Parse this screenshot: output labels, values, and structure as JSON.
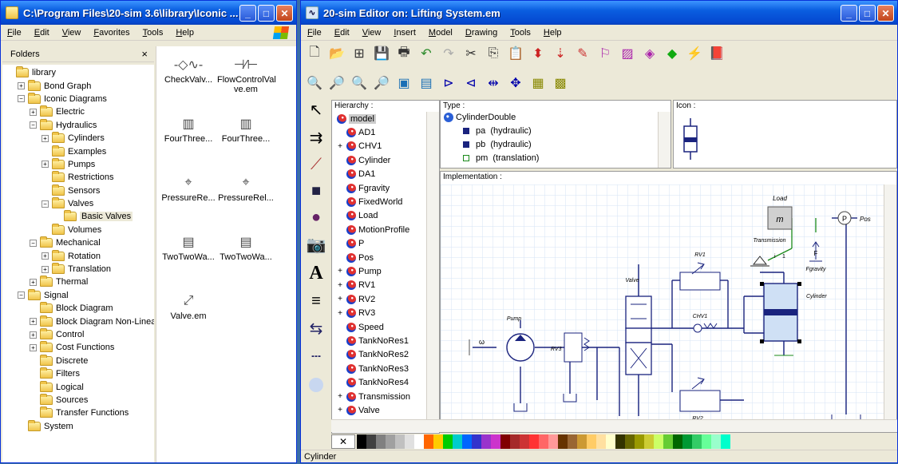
{
  "explorer": {
    "title": "C:\\Program Files\\20-sim 3.6\\library\\Iconic ...",
    "menu": [
      "File",
      "Edit",
      "View",
      "Favorites",
      "Tools",
      "Help"
    ],
    "folders_label": "Folders",
    "close_label": "×",
    "tree": [
      {
        "label": "library",
        "depth": 0,
        "pm": "",
        "selected": false
      },
      {
        "label": "Bond Graph",
        "depth": 1,
        "pm": "+",
        "selected": false
      },
      {
        "label": "Iconic Diagrams",
        "depth": 1,
        "pm": "−",
        "selected": false
      },
      {
        "label": "Electric",
        "depth": 2,
        "pm": "+",
        "selected": false
      },
      {
        "label": "Hydraulics",
        "depth": 2,
        "pm": "−",
        "selected": false
      },
      {
        "label": "Cylinders",
        "depth": 3,
        "pm": "+",
        "selected": false
      },
      {
        "label": "Examples",
        "depth": 3,
        "pm": "",
        "selected": false
      },
      {
        "label": "Pumps",
        "depth": 3,
        "pm": "+",
        "selected": false
      },
      {
        "label": "Restrictions",
        "depth": 3,
        "pm": "",
        "selected": false
      },
      {
        "label": "Sensors",
        "depth": 3,
        "pm": "",
        "selected": false
      },
      {
        "label": "Valves",
        "depth": 3,
        "pm": "−",
        "selected": false
      },
      {
        "label": "Basic Valves",
        "depth": 4,
        "pm": "",
        "selected": true
      },
      {
        "label": "Volumes",
        "depth": 3,
        "pm": "",
        "selected": false
      },
      {
        "label": "Mechanical",
        "depth": 2,
        "pm": "−",
        "selected": false
      },
      {
        "label": "Rotation",
        "depth": 3,
        "pm": "+",
        "selected": false
      },
      {
        "label": "Translation",
        "depth": 3,
        "pm": "+",
        "selected": false
      },
      {
        "label": "Thermal",
        "depth": 2,
        "pm": "+",
        "selected": false
      },
      {
        "label": "Signal",
        "depth": 1,
        "pm": "−",
        "selected": false
      },
      {
        "label": "Block Diagram",
        "depth": 2,
        "pm": "",
        "selected": false
      },
      {
        "label": "Block Diagram Non-Linear",
        "depth": 2,
        "pm": "+",
        "selected": false
      },
      {
        "label": "Control",
        "depth": 2,
        "pm": "+",
        "selected": false
      },
      {
        "label": "Cost Functions",
        "depth": 2,
        "pm": "+",
        "selected": false
      },
      {
        "label": "Discrete",
        "depth": 2,
        "pm": "",
        "selected": false
      },
      {
        "label": "Filters",
        "depth": 2,
        "pm": "",
        "selected": false
      },
      {
        "label": "Logical",
        "depth": 2,
        "pm": "",
        "selected": false
      },
      {
        "label": "Sources",
        "depth": 2,
        "pm": "",
        "selected": false
      },
      {
        "label": "Transfer Functions",
        "depth": 2,
        "pm": "",
        "selected": false
      },
      {
        "label": "System",
        "depth": 1,
        "pm": "",
        "selected": false
      }
    ],
    "files": [
      {
        "label": "CheckValv...",
        "icon": "check-valve-icon"
      },
      {
        "label": "FlowControlVal ve.em",
        "icon": "flow-control-valve-icon"
      },
      {
        "label": "FourThree...",
        "icon": "four-three-valve-icon"
      },
      {
        "label": "FourThree...",
        "icon": "four-three-valve-icon"
      },
      {
        "label": "PressureRe...",
        "icon": "pressure-relief-valve-icon"
      },
      {
        "label": "PressureRel...",
        "icon": "pressure-relief-valve-icon"
      },
      {
        "label": "TwoTwoWa...",
        "icon": "two-two-valve-icon"
      },
      {
        "label": "TwoTwoWa...",
        "icon": "two-two-valve-icon"
      },
      {
        "label": "Valve.em",
        "icon": "variable-valve-icon"
      }
    ]
  },
  "editor": {
    "title": "20-sim Editor on: Lifting System.em",
    "menu": [
      "File",
      "Edit",
      "View",
      "Insert",
      "Model",
      "Drawing",
      "Tools",
      "Help"
    ],
    "hierarchy_label": "Hierarchy :",
    "type_label": "Type :",
    "icon_label": "Icon :",
    "implementation_label": "Implementation :",
    "hierarchy": [
      {
        "label": "model",
        "pm": "",
        "selected": true
      },
      {
        "label": "AD1",
        "pm": ""
      },
      {
        "label": "CHV1",
        "pm": "+"
      },
      {
        "label": "Cylinder",
        "pm": ""
      },
      {
        "label": "DA1",
        "pm": ""
      },
      {
        "label": "Fgravity",
        "pm": ""
      },
      {
        "label": "FixedWorld",
        "pm": ""
      },
      {
        "label": "Load",
        "pm": ""
      },
      {
        "label": "MotionProfile",
        "pm": ""
      },
      {
        "label": "P",
        "pm": ""
      },
      {
        "label": "Pos",
        "pm": ""
      },
      {
        "label": "Pump",
        "pm": "+"
      },
      {
        "label": "RV1",
        "pm": "+"
      },
      {
        "label": "RV2",
        "pm": "+"
      },
      {
        "label": "RV3",
        "pm": "+"
      },
      {
        "label": "Speed",
        "pm": ""
      },
      {
        "label": "TankNoRes1",
        "pm": ""
      },
      {
        "label": "TankNoRes2",
        "pm": ""
      },
      {
        "label": "TankNoRes3",
        "pm": ""
      },
      {
        "label": "TankNoRes4",
        "pm": ""
      },
      {
        "label": "Transmission",
        "pm": "+"
      },
      {
        "label": "Valve",
        "pm": "+"
      }
    ],
    "type": {
      "name": "CylinderDouble",
      "ports": [
        {
          "label": "pa  (hydraulic)",
          "filled": true
        },
        {
          "label": "pb  (hydraulic)",
          "filled": true
        },
        {
          "label": "pm  (translation)",
          "filled": false
        }
      ]
    },
    "diagram_labels": {
      "load": "Load",
      "mass": "m",
      "pos": "Pos",
      "pos_sensor": "P",
      "transmission": "Transmission",
      "force": "F",
      "fgravity": "Fgravity",
      "cylinder": "Cylinder",
      "rv1": "RV1",
      "chv1": "CHV1",
      "valve": "Valve",
      "pump": "Pump",
      "rv3": "RV3",
      "rv2": "RV2",
      "omega": "ω",
      "trans_i": "i",
      "trans_1": "1"
    },
    "status": "Cylinder"
  },
  "colors": {
    "title_blue": "#0a5ee0",
    "xp_face": "#ece9d8",
    "diagram_line": "#1a237e",
    "grid": "#d6e3f5"
  },
  "palette": [
    "#ffffff",
    "#000000",
    "#404040",
    "#808080",
    "#a0a0a0",
    "#c0c0c0",
    "#e0e0e0",
    "#ffffff",
    "#ff6600",
    "#ffcc00",
    "#00cc00",
    "#00cccc",
    "#0066ff",
    "#3333cc",
    "#9933cc",
    "#cc33cc",
    "#800000",
    "#a52a2a",
    "#cc3333",
    "#ff3333",
    "#ff6666",
    "#ff9999",
    "#663300",
    "#996633",
    "#cc9933",
    "#ffcc66",
    "#ffe0a0",
    "#ffffcc",
    "#333300",
    "#666600",
    "#999900",
    "#cccc33",
    "#ccff66",
    "#66cc33",
    "#006600",
    "#009933",
    "#33cc66",
    "#66ff99",
    "#99ffcc",
    "#00ffcc"
  ]
}
